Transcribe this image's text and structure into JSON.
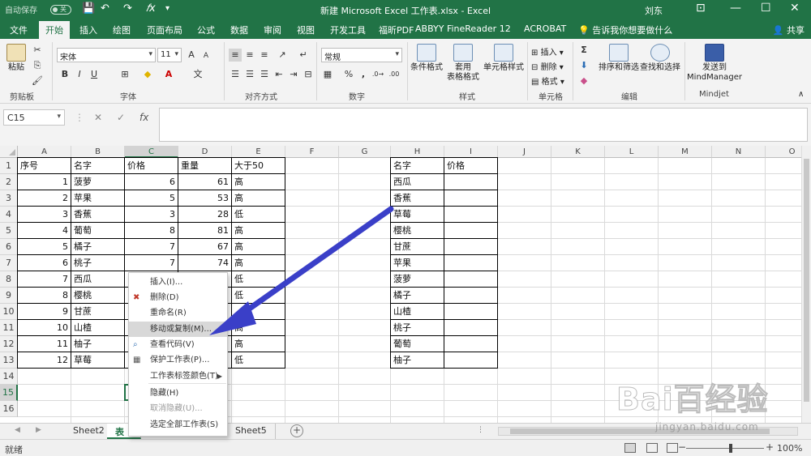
{
  "titlebar": {
    "autosave_label": "自动保存",
    "autosave_state": "关",
    "title": "新建 Microsoft Excel 工作表.xlsx  -  Excel",
    "user": "刘东"
  },
  "ribbon_tabs": [
    "文件",
    "开始",
    "插入",
    "绘图",
    "页面布局",
    "公式",
    "数据",
    "审阅",
    "视图",
    "开发工具",
    "福昕PDF",
    "ABBYY FineReader 12",
    "ACROBAT"
  ],
  "active_tab": "开始",
  "tell_me": "告诉我你想要做什么",
  "share_label": "共享",
  "ribbon": {
    "clipboard": {
      "paste": "粘贴",
      "group": "剪贴板"
    },
    "font": {
      "name": "宋体",
      "size": "11",
      "group": "字体",
      "bold": "B",
      "italic": "I",
      "underline": "U",
      "grow": "A",
      "shrink": "A",
      "wen": "文"
    },
    "alignment": {
      "group": "对齐方式"
    },
    "number": {
      "format": "常规",
      "group": "数字",
      "percent": "%",
      "comma": ","
    },
    "styles": {
      "conditional": "条件格式",
      "table_fmt_1": "套用",
      "table_fmt_2": "表格格式",
      "cell_styles": "单元格样式",
      "group": "样式"
    },
    "cells": {
      "insert": "插入",
      "delete": "删除",
      "format": "格式",
      "group": "单元格"
    },
    "editing": {
      "sort_filter": "排序和筛选",
      "find_select": "查找和选择",
      "group": "编辑"
    },
    "mindjet": {
      "send_1": "发送到",
      "send_2": "MindManager",
      "group": "Mindjet"
    }
  },
  "formula_bar": {
    "name_box": "C15",
    "cancel": "✕",
    "enter": "✓",
    "fx": "fx",
    "content": ""
  },
  "columns": [
    "A",
    "B",
    "C",
    "D",
    "E",
    "F",
    "G",
    "H",
    "I",
    "J",
    "K",
    "L",
    "M",
    "N",
    "O"
  ],
  "selected_column": "C",
  "rows": [
    "1",
    "2",
    "3",
    "4",
    "5",
    "6",
    "7",
    "8",
    "9",
    "10",
    "11",
    "12",
    "13",
    "14",
    "15",
    "16"
  ],
  "selected_row": "15",
  "table1": {
    "headers": [
      "序号",
      "名字",
      "价格",
      "重量",
      "大于50"
    ],
    "rows": [
      [
        "1",
        "菠萝",
        "6",
        "61",
        "高"
      ],
      [
        "2",
        "苹果",
        "5",
        "53",
        "高"
      ],
      [
        "3",
        "香蕉",
        "3",
        "28",
        "低"
      ],
      [
        "4",
        "葡萄",
        "8",
        "81",
        "高"
      ],
      [
        "5",
        "橘子",
        "7",
        "67",
        "高"
      ],
      [
        "6",
        "桃子",
        "7",
        "74",
        "高"
      ],
      [
        "7",
        "西瓜",
        "",
        "",
        "低"
      ],
      [
        "8",
        "樱桃",
        "",
        "",
        "低"
      ],
      [
        "9",
        "甘蔗",
        "",
        "",
        ""
      ],
      [
        "10",
        "山楂",
        "",
        "",
        "高"
      ],
      [
        "11",
        "柚子",
        "",
        "",
        "高"
      ],
      [
        "12",
        "草莓",
        "",
        "",
        "低"
      ]
    ]
  },
  "table2": {
    "headers": [
      "名字",
      "价格"
    ],
    "names": [
      "西瓜",
      "香蕉",
      "草莓",
      "樱桃",
      "甘蔗",
      "苹果",
      "菠萝",
      "橘子",
      "山楂",
      "桃子",
      "葡萄",
      "柚子"
    ]
  },
  "context_menu": {
    "items": [
      {
        "label": "插入(I)...",
        "enabled": true,
        "icon": ""
      },
      {
        "label": "删除(D)",
        "enabled": true,
        "icon": "delete-sheet-icon"
      },
      {
        "label": "重命名(R)",
        "enabled": true,
        "icon": ""
      },
      {
        "label": "移动或复制(M)...",
        "enabled": true,
        "icon": "",
        "highlighted": true
      },
      {
        "label": "查看代码(V)",
        "enabled": true,
        "icon": "view-code-icon"
      },
      {
        "label": "保护工作表(P)...",
        "enabled": true,
        "icon": "protect-sheet-icon"
      },
      {
        "label": "工作表标签颜色(T)",
        "enabled": true,
        "icon": "",
        "submenu": true
      },
      {
        "label": "隐藏(H)",
        "enabled": true,
        "icon": ""
      },
      {
        "label": "取消隐藏(U)...",
        "enabled": false,
        "icon": ""
      },
      {
        "label": "选定全部工作表(S)",
        "enabled": true,
        "icon": ""
      }
    ]
  },
  "sheet_tabs": [
    "Sheet2",
    "表单",
    "Sheet5"
  ],
  "active_sheet": "表单",
  "status": {
    "ready": "就绪",
    "zoom": "100%"
  },
  "watermark": {
    "logo": "Bai百经验",
    "url": "jingyan.baidu.com"
  },
  "colors": {
    "excel_green": "#217346",
    "arrow_blue": "#3a3fc8"
  }
}
